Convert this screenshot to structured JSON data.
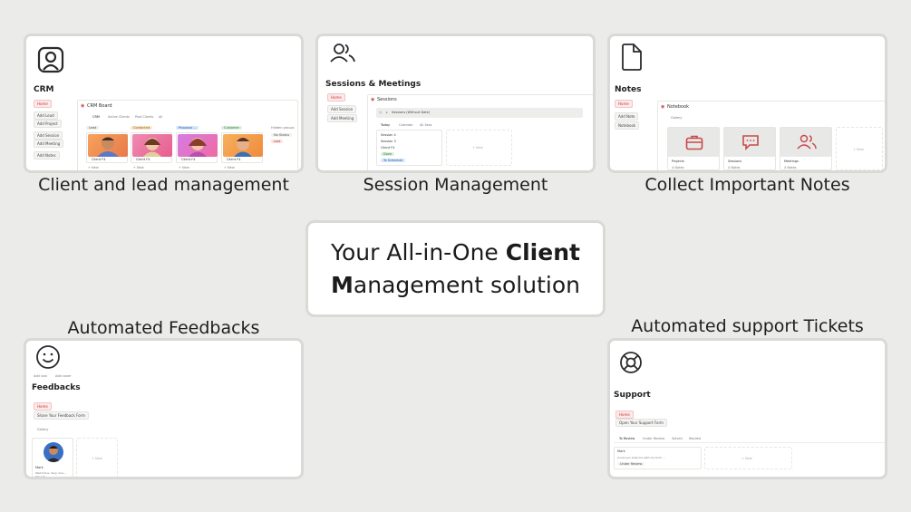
{
  "hero": {
    "line1_prefix": "Your All-in-One ",
    "line1_bold": "Client",
    "line2_bold": "M",
    "line2_rest": "anagement solution"
  },
  "captions": {
    "crm": "Client and lead management",
    "sessions": "Session Management",
    "notes": "Collect Important Notes",
    "feedbacks": "Automated Feedbacks",
    "support": "Automated support Tickets"
  },
  "crm": {
    "title": "CRM",
    "home": "Home",
    "buttons": [
      "Add Lead",
      "Add Project",
      "Add Session",
      "Add Meeting",
      "Add Notes"
    ],
    "board_title": "CRM Board",
    "tabs": [
      "CRM",
      "Active Clients",
      "Past Clients",
      "All"
    ],
    "columns": [
      {
        "label": "Lead",
        "color": "#eeeeed",
        "text": "#555555"
      },
      {
        "label": "Contacted",
        "color": "#fbe4c9",
        "text": "#9a5a12"
      },
      {
        "label": "Proposal ...",
        "color": "#d6e6fb",
        "text": "#2a5b9e"
      },
      {
        "label": "Customer",
        "color": "#d9f0dc",
        "text": "#2f7a3b"
      }
    ],
    "cards": [
      "Client F4",
      "Client F4",
      "Client F4",
      "Client F4"
    ],
    "new_label": "+ New",
    "hidden_groups": "Hidden groups",
    "hidden_items": [
      "No Status",
      "Lost"
    ]
  },
  "sessions": {
    "title": "Sessions & Meetings",
    "home": "Home",
    "buttons": [
      "Add Session",
      "Add Meeting"
    ],
    "db_title": "Sessions",
    "group_label": "Sessions (Without Date)",
    "tabs": [
      "Today",
      "Calendar",
      "All Sess"
    ],
    "items": [
      "Session 4",
      "Session 3",
      "Client F4",
      "Done",
      "To Schedule"
    ],
    "new_label": "+ New"
  },
  "notes": {
    "title": "Notes",
    "home": "Home",
    "buttons": [
      "Add Note",
      "Notebook"
    ],
    "db_title": "Notebook",
    "view": "Gallery",
    "cards": [
      {
        "label": "Projects",
        "count": "4 Notes"
      },
      {
        "label": "Sessions",
        "count": "4 Notes"
      },
      {
        "label": "Meetings",
        "count": "4 Notes"
      }
    ],
    "new_label": "+ New",
    "accent": "#c94a4a"
  },
  "feedbacks": {
    "title": "Feedbacks",
    "props": [
      "Add icon",
      "Add cover"
    ],
    "home": "Home",
    "share_button": "Share Your Feedback Form",
    "view": "Gallery",
    "card_name": "Mark",
    "card_text": [
      "Well Done, Very nice...",
      "The UI/..."
    ],
    "new_label": "+ New"
  },
  "support": {
    "title": "Support",
    "home": "Home",
    "open_button": "Open Your Support Form",
    "tabs": [
      "To Review",
      "Under Review",
      "Solved",
      "Replied"
    ],
    "ticket_name": "Mark",
    "ticket_text": "Could you help me with my form ...",
    "ticket_tag": "Under Review",
    "new_label": "+ New"
  }
}
